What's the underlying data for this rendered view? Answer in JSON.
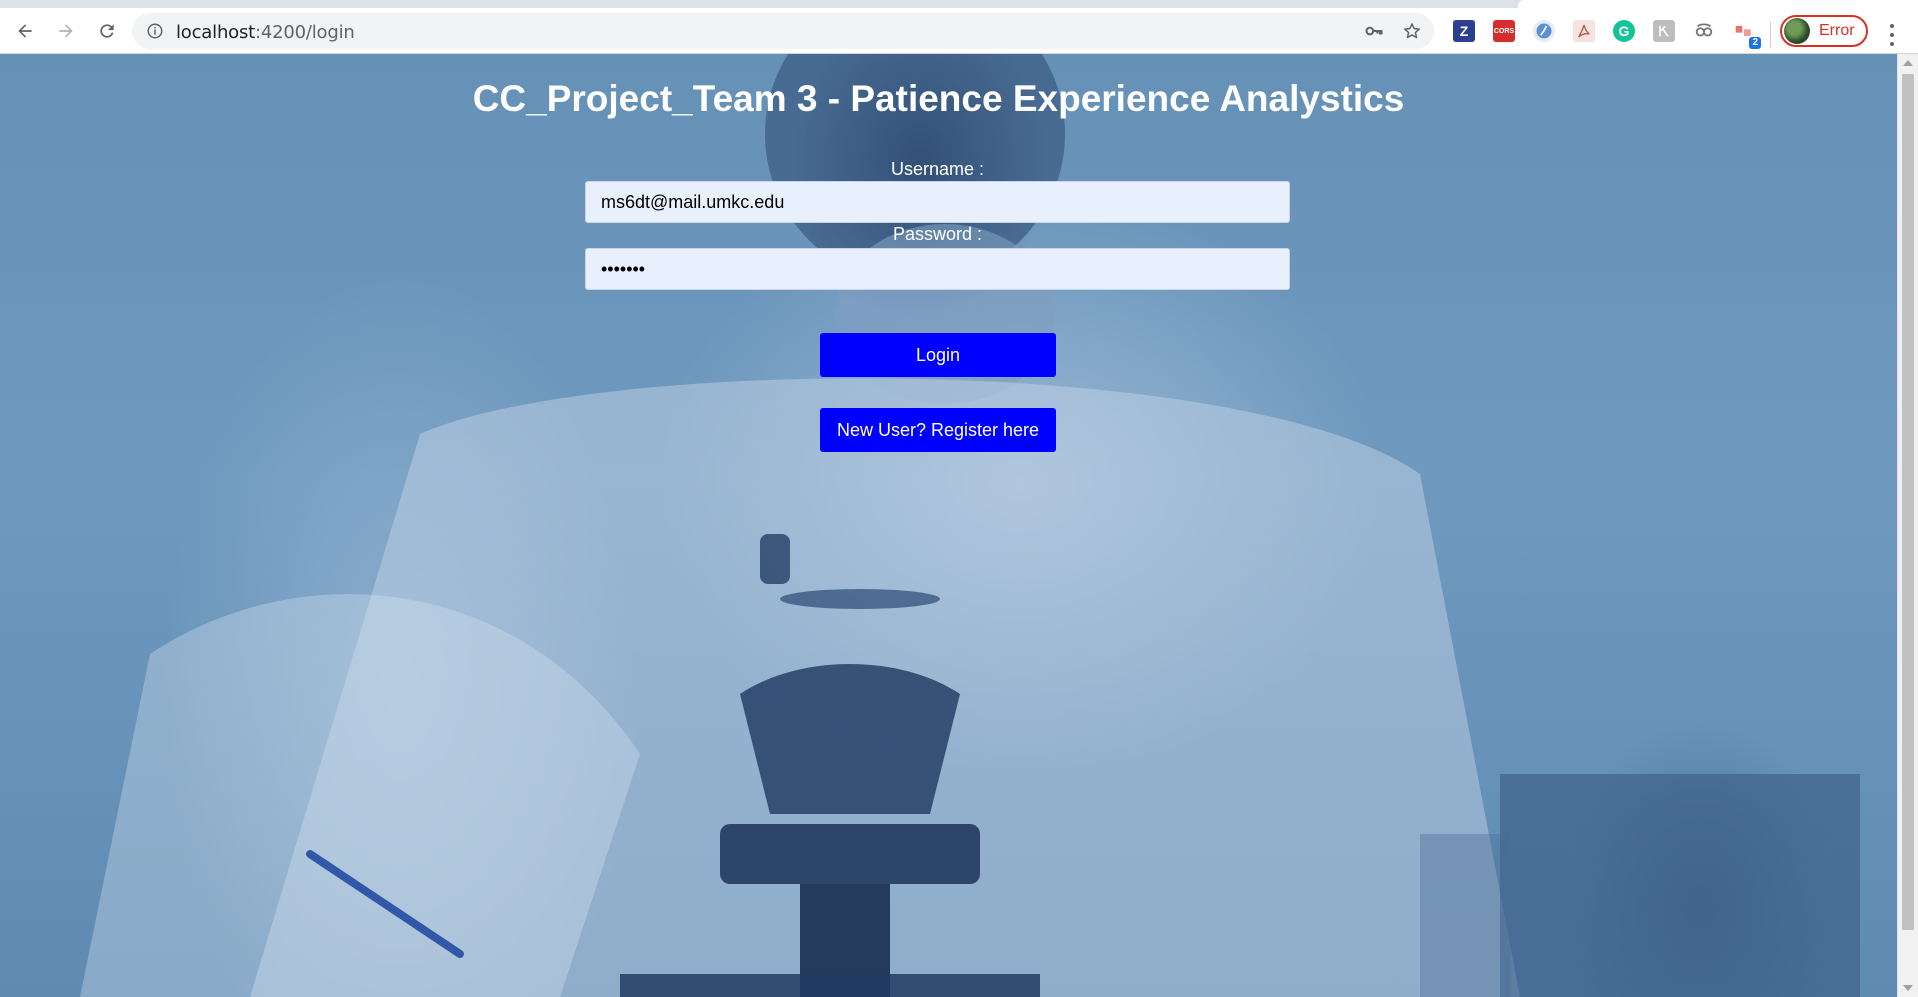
{
  "browser": {
    "url_host": "localhost",
    "url_path": ":4200/login",
    "profile_status": "Error",
    "extensions": [
      {
        "name": "zotero-extension-icon",
        "glyph": "Z",
        "color": "#2c3e8f"
      },
      {
        "name": "cors-extension-icon",
        "glyph": "CORS",
        "color": "#d32f2f"
      },
      {
        "name": "globe-extension-icon",
        "glyph": "",
        "color": "#5b8fd6"
      },
      {
        "name": "pdf-extension-icon",
        "glyph": "",
        "color": "#b05a4a"
      },
      {
        "name": "grammarly-extension-icon",
        "glyph": "G",
        "color": "#15c39a"
      },
      {
        "name": "extension-icon",
        "glyph": "",
        "color": "#9e9e9e"
      },
      {
        "name": "link-extension-icon",
        "glyph": "",
        "color": "#757575"
      },
      {
        "name": "tab-extension-icon",
        "glyph": "",
        "color": "#e57373",
        "badge": "2"
      }
    ]
  },
  "page": {
    "title": "CC_Project_Team 3 - Patience Experience Analystics",
    "username_label": "Username :",
    "username_value": "ms6dt@mail.umkc.edu",
    "password_label": "Password :",
    "password_value": "•••••••",
    "login_button": "Login",
    "register_button": "New User? Register here"
  },
  "colors": {
    "button_bg": "#0000ff",
    "input_bg": "#e8f0fe",
    "overlay": "#6691b7"
  }
}
